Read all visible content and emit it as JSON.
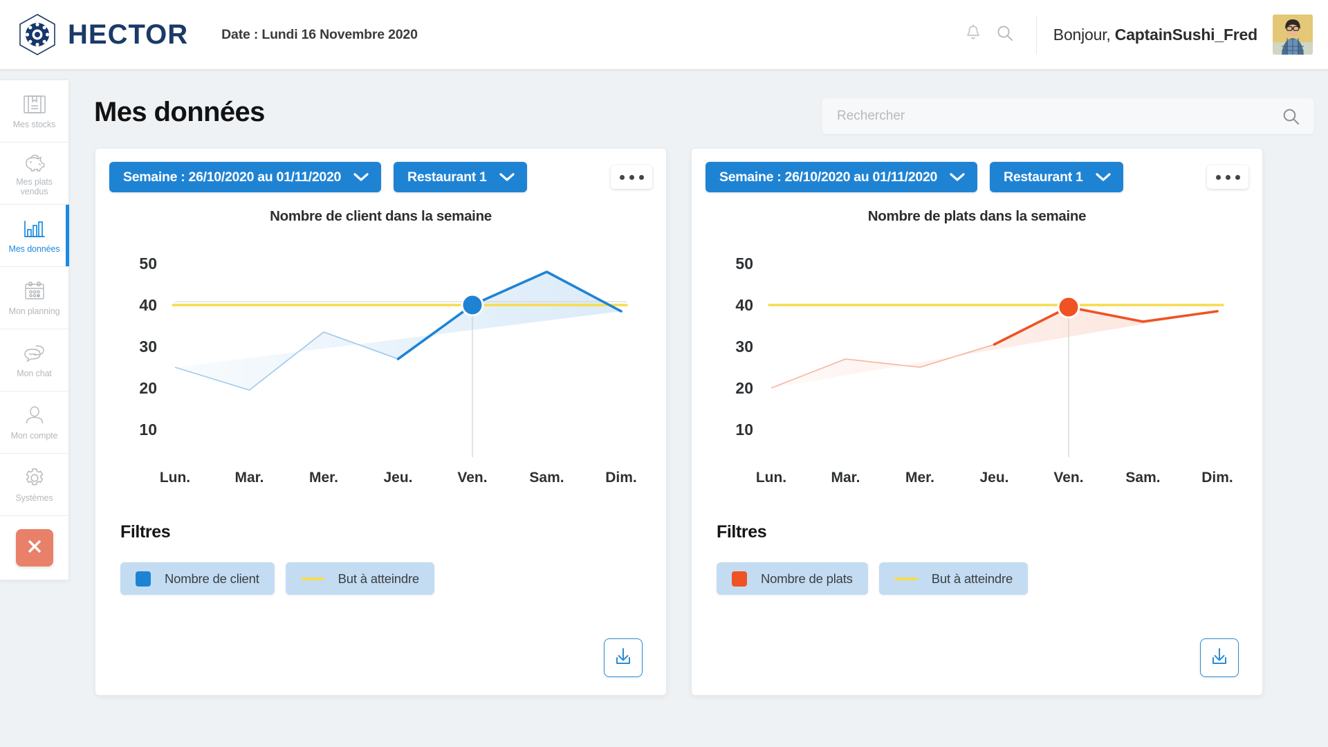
{
  "header": {
    "logo_text": "HECTOR",
    "date_label": "Date : Lundi 16 Novembre 2020",
    "greeting_prefix": "Bonjour, ",
    "username": "CaptainSushi_Fred",
    "bell_icon": "bell-icon",
    "search_icon": "search-icon",
    "avatar_alt": "user-avatar"
  },
  "sidebar": {
    "items": [
      {
        "label": "Mes stocks",
        "icon": "book-icon",
        "active": false
      },
      {
        "label": "Mes plats vendus",
        "icon": "piggy-bank-icon",
        "active": false
      },
      {
        "label": "Mes données",
        "icon": "bar-chart-icon",
        "active": true
      },
      {
        "label": "Mon planning",
        "icon": "calendar-icon",
        "active": false
      },
      {
        "label": "Mon chat",
        "icon": "chat-icon",
        "active": false
      },
      {
        "label": "Mon compte",
        "icon": "user-icon",
        "active": false
      },
      {
        "label": "Systèmes",
        "icon": "gear-icon",
        "active": false
      }
    ],
    "close_button": {
      "icon": "close-icon",
      "color": "#e8806a"
    }
  },
  "page": {
    "title": "Mes données",
    "search_placeholder": "Rechercher",
    "search_value": ""
  },
  "cards": [
    {
      "week_label": "Semaine : 26/10/2020 au 01/11/2020",
      "restaurant_label": "Restaurant 1",
      "menu_icon": "kebab-menu-icon",
      "filters_title": "Filtres",
      "legend": [
        {
          "label": "Nombre de client",
          "marker": "square",
          "color": "#1f83d4"
        },
        {
          "label": "But à atteindre",
          "marker": "line",
          "color": "#f7dc4e"
        }
      ],
      "download_icon": "download-icon"
    },
    {
      "week_label": "Semaine : 26/10/2020 au 01/11/2020",
      "restaurant_label": "Restaurant 1",
      "menu_icon": "kebab-menu-icon",
      "filters_title": "Filtres",
      "legend": [
        {
          "label": "Nombre de plats",
          "marker": "square",
          "color": "#ef5223"
        },
        {
          "label": "But à atteindre",
          "marker": "line",
          "color": "#f7dc4e"
        }
      ],
      "download_icon": "download-icon"
    }
  ],
  "chart_data": [
    {
      "type": "line",
      "title": "Nombre de client dans la semaine",
      "xlabel": "",
      "ylabel": "",
      "categories": [
        "Lun.",
        "Mar.",
        "Mer.",
        "Jeu.",
        "Ven.",
        "Sam.",
        "Dim."
      ],
      "series": [
        {
          "name": "Nombre de client",
          "values": [
            25,
            19.5,
            33.5,
            27,
            40,
            48,
            38.5
          ],
          "color": "#1f83d4"
        },
        {
          "name": "But à atteindre",
          "values": [
            40,
            40,
            40,
            40,
            40,
            40,
            40
          ],
          "color": "#f7dc4e",
          "style": "goal-line"
        }
      ],
      "yticks": [
        10,
        20,
        30,
        40,
        50
      ],
      "ylim": [
        5,
        55
      ],
      "grid": false,
      "legend_position": "bottom",
      "highlight": {
        "category": "Ven.",
        "value": 40,
        "color": "#1f83d4"
      },
      "fade_before_index": 3
    },
    {
      "type": "line",
      "title": "Nombre de plats dans la semaine",
      "xlabel": "",
      "ylabel": "",
      "categories": [
        "Lun.",
        "Mar.",
        "Mer.",
        "Jeu.",
        "Ven.",
        "Sam.",
        "Dim."
      ],
      "series": [
        {
          "name": "Nombre de plats",
          "values": [
            20,
            27,
            25,
            30.5,
            39.5,
            36,
            38.5
          ],
          "color": "#ef5223"
        },
        {
          "name": "But à atteindre",
          "values": [
            40,
            40,
            40,
            40,
            40,
            40,
            40
          ],
          "color": "#f7dc4e",
          "style": "goal-line"
        }
      ],
      "yticks": [
        10,
        20,
        30,
        40,
        50
      ],
      "ylim": [
        5,
        55
      ],
      "grid": false,
      "legend_position": "bottom",
      "highlight": {
        "category": "Ven.",
        "value": 39.5,
        "color": "#ef5223"
      },
      "fade_before_index": 3
    }
  ]
}
